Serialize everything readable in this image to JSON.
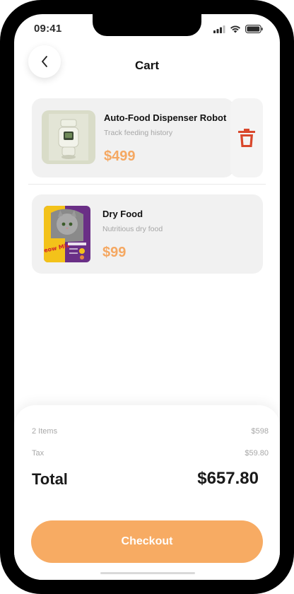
{
  "status_bar": {
    "time": "09:41",
    "icons": [
      "signal-icon",
      "wifi-icon",
      "battery-icon"
    ]
  },
  "header": {
    "back_icon": "chevron-left-icon",
    "title": "Cart"
  },
  "cart_items": [
    {
      "name": "Auto-Food Dispenser Robot",
      "subtitle": "Track feeding history",
      "price": "$499",
      "image": "food-dispenser-robot-image",
      "delete_icon": "trash-icon"
    },
    {
      "name": "Dry Food",
      "subtitle": "Nutritious dry food",
      "price": "$99",
      "image": "meow-mix-bag-image",
      "image_text": "Meow Mix"
    }
  ],
  "summary": {
    "items_label": "2 Items",
    "items_value": "$598",
    "tax_label": "Tax",
    "tax_value": "$59.80",
    "total_label": "Total",
    "total_value": "$657.80"
  },
  "checkout_label": "Checkout",
  "colors": {
    "accent": "#f7ab63",
    "price": "#f5a862",
    "delete": "#d9482c",
    "card_bg": "#f1f1f1"
  }
}
